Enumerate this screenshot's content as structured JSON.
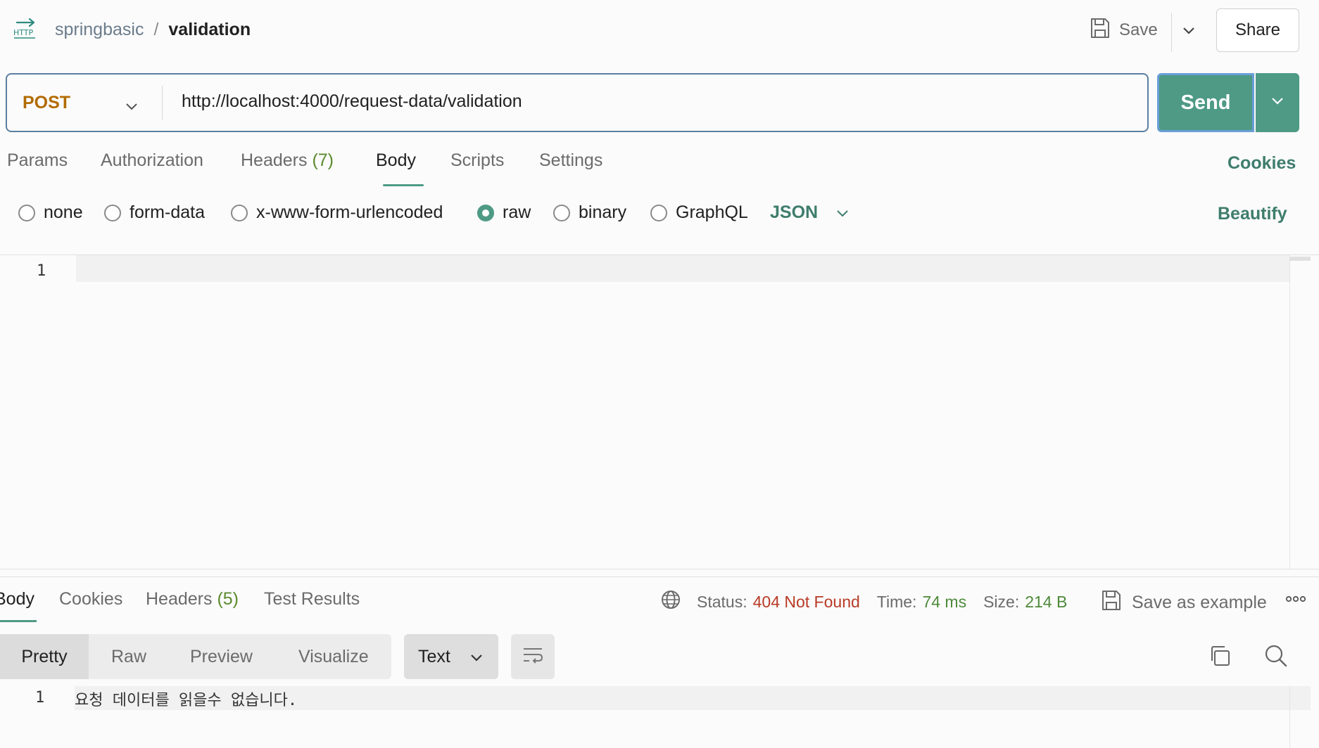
{
  "header": {
    "http_icon_label": "HTTP",
    "collection": "springbasic",
    "separator": "/",
    "request_name": "validation",
    "save_label": "Save",
    "share_label": "Share"
  },
  "request": {
    "method": "POST",
    "url": "http://localhost:4000/request-data/validation",
    "send_label": "Send"
  },
  "request_tabs": {
    "params": "Params",
    "authorization": "Authorization",
    "headers": "Headers",
    "headers_count": "(7)",
    "body": "Body",
    "scripts": "Scripts",
    "settings": "Settings",
    "cookies": "Cookies"
  },
  "body_types": {
    "options": [
      "none",
      "form-data",
      "x-www-form-urlencoded",
      "raw",
      "binary",
      "GraphQL"
    ],
    "selected": "raw",
    "format": "JSON",
    "beautify": "Beautify"
  },
  "request_editor": {
    "line_numbers": [
      "1"
    ],
    "content": ""
  },
  "response_tabs": {
    "body": "Body",
    "cookies": "Cookies",
    "headers": "Headers",
    "headers_count": "(5)",
    "test_results": "Test Results"
  },
  "response_meta": {
    "status_label": "Status:",
    "status_value": "404 Not Found",
    "time_label": "Time:",
    "time_value": "74 ms",
    "size_label": "Size:",
    "size_value": "214 B",
    "save_example": "Save as example"
  },
  "response_view": {
    "modes": [
      "Pretty",
      "Raw",
      "Preview",
      "Visualize"
    ],
    "selected_mode": "Pretty",
    "format": "Text"
  },
  "response_editor": {
    "line_number": "1",
    "content": "요청 데이터를 읽을수 없습니다."
  },
  "colors": {
    "accent": "#4e9a85",
    "method": "#b26b00",
    "error": "#b83a26",
    "success": "#4e8a3a"
  }
}
